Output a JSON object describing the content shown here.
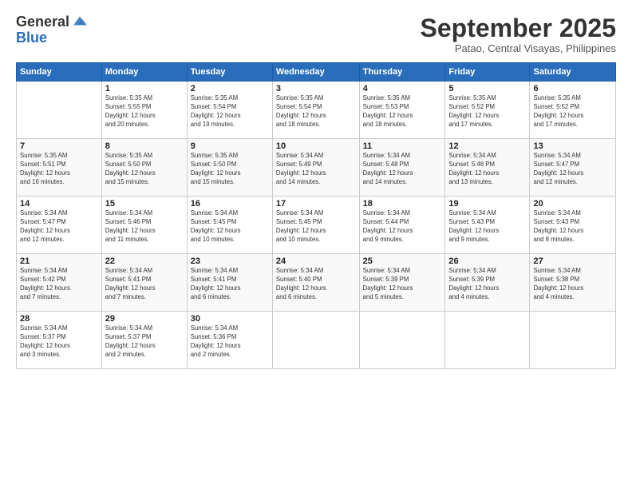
{
  "logo": {
    "general": "General",
    "blue": "Blue"
  },
  "header": {
    "month": "September 2025",
    "location": "Patao, Central Visayas, Philippines"
  },
  "weekdays": [
    "Sunday",
    "Monday",
    "Tuesday",
    "Wednesday",
    "Thursday",
    "Friday",
    "Saturday"
  ],
  "weeks": [
    [
      {
        "day": "",
        "info": ""
      },
      {
        "day": "1",
        "info": "Sunrise: 5:35 AM\nSunset: 5:55 PM\nDaylight: 12 hours\nand 20 minutes."
      },
      {
        "day": "2",
        "info": "Sunrise: 5:35 AM\nSunset: 5:54 PM\nDaylight: 12 hours\nand 19 minutes."
      },
      {
        "day": "3",
        "info": "Sunrise: 5:35 AM\nSunset: 5:54 PM\nDaylight: 12 hours\nand 18 minutes."
      },
      {
        "day": "4",
        "info": "Sunrise: 5:35 AM\nSunset: 5:53 PM\nDaylight: 12 hours\nand 18 minutes."
      },
      {
        "day": "5",
        "info": "Sunrise: 5:35 AM\nSunset: 5:52 PM\nDaylight: 12 hours\nand 17 minutes."
      },
      {
        "day": "6",
        "info": "Sunrise: 5:35 AM\nSunset: 5:52 PM\nDaylight: 12 hours\nand 17 minutes."
      }
    ],
    [
      {
        "day": "7",
        "info": "Sunrise: 5:35 AM\nSunset: 5:51 PM\nDaylight: 12 hours\nand 16 minutes."
      },
      {
        "day": "8",
        "info": "Sunrise: 5:35 AM\nSunset: 5:50 PM\nDaylight: 12 hours\nand 15 minutes."
      },
      {
        "day": "9",
        "info": "Sunrise: 5:35 AM\nSunset: 5:50 PM\nDaylight: 12 hours\nand 15 minutes."
      },
      {
        "day": "10",
        "info": "Sunrise: 5:34 AM\nSunset: 5:49 PM\nDaylight: 12 hours\nand 14 minutes."
      },
      {
        "day": "11",
        "info": "Sunrise: 5:34 AM\nSunset: 5:48 PM\nDaylight: 12 hours\nand 14 minutes."
      },
      {
        "day": "12",
        "info": "Sunrise: 5:34 AM\nSunset: 5:48 PM\nDaylight: 12 hours\nand 13 minutes."
      },
      {
        "day": "13",
        "info": "Sunrise: 5:34 AM\nSunset: 5:47 PM\nDaylight: 12 hours\nand 12 minutes."
      }
    ],
    [
      {
        "day": "14",
        "info": "Sunrise: 5:34 AM\nSunset: 5:47 PM\nDaylight: 12 hours\nand 12 minutes."
      },
      {
        "day": "15",
        "info": "Sunrise: 5:34 AM\nSunset: 5:46 PM\nDaylight: 12 hours\nand 11 minutes."
      },
      {
        "day": "16",
        "info": "Sunrise: 5:34 AM\nSunset: 5:45 PM\nDaylight: 12 hours\nand 10 minutes."
      },
      {
        "day": "17",
        "info": "Sunrise: 5:34 AM\nSunset: 5:45 PM\nDaylight: 12 hours\nand 10 minutes."
      },
      {
        "day": "18",
        "info": "Sunrise: 5:34 AM\nSunset: 5:44 PM\nDaylight: 12 hours\nand 9 minutes."
      },
      {
        "day": "19",
        "info": "Sunrise: 5:34 AM\nSunset: 5:43 PM\nDaylight: 12 hours\nand 9 minutes."
      },
      {
        "day": "20",
        "info": "Sunrise: 5:34 AM\nSunset: 5:43 PM\nDaylight: 12 hours\nand 8 minutes."
      }
    ],
    [
      {
        "day": "21",
        "info": "Sunrise: 5:34 AM\nSunset: 5:42 PM\nDaylight: 12 hours\nand 7 minutes."
      },
      {
        "day": "22",
        "info": "Sunrise: 5:34 AM\nSunset: 5:41 PM\nDaylight: 12 hours\nand 7 minutes."
      },
      {
        "day": "23",
        "info": "Sunrise: 5:34 AM\nSunset: 5:41 PM\nDaylight: 12 hours\nand 6 minutes."
      },
      {
        "day": "24",
        "info": "Sunrise: 5:34 AM\nSunset: 5:40 PM\nDaylight: 12 hours\nand 6 minutes."
      },
      {
        "day": "25",
        "info": "Sunrise: 5:34 AM\nSunset: 5:39 PM\nDaylight: 12 hours\nand 5 minutes."
      },
      {
        "day": "26",
        "info": "Sunrise: 5:34 AM\nSunset: 5:39 PM\nDaylight: 12 hours\nand 4 minutes."
      },
      {
        "day": "27",
        "info": "Sunrise: 5:34 AM\nSunset: 5:38 PM\nDaylight: 12 hours\nand 4 minutes."
      }
    ],
    [
      {
        "day": "28",
        "info": "Sunrise: 5:34 AM\nSunset: 5:37 PM\nDaylight: 12 hours\nand 3 minutes."
      },
      {
        "day": "29",
        "info": "Sunrise: 5:34 AM\nSunset: 5:37 PM\nDaylight: 12 hours\nand 2 minutes."
      },
      {
        "day": "30",
        "info": "Sunrise: 5:34 AM\nSunset: 5:36 PM\nDaylight: 12 hours\nand 2 minutes."
      },
      {
        "day": "",
        "info": ""
      },
      {
        "day": "",
        "info": ""
      },
      {
        "day": "",
        "info": ""
      },
      {
        "day": "",
        "info": ""
      }
    ]
  ]
}
